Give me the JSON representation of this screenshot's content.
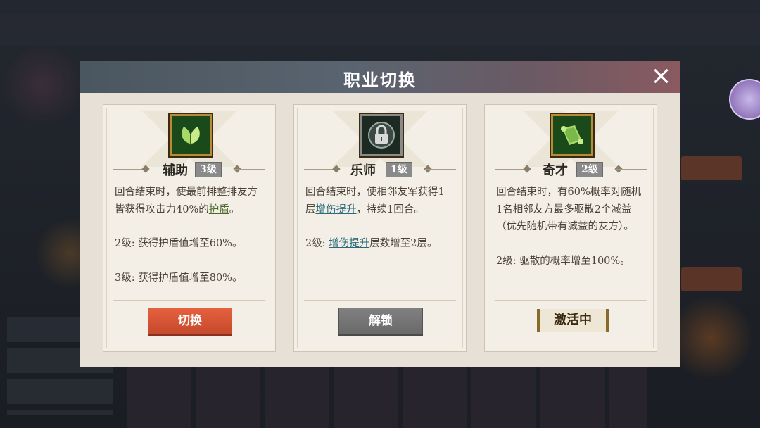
{
  "modal": {
    "title": "职业切换"
  },
  "cards": [
    {
      "name": "辅助",
      "level": "3级",
      "icon": "leaf-icon",
      "desc1_a": "回合结束时，使最前排整排友方皆获得攻击力40%的",
      "desc1_kw": "护盾",
      "desc1_b": "。",
      "desc2": "2级: 获得护盾值增至60%。",
      "desc3": "3级: 获得护盾值增至80%。",
      "button": "切换"
    },
    {
      "name": "乐师",
      "level": "1级",
      "icon": "lock-icon",
      "desc1_a": "回合结束时，使相邻友军获得1层",
      "desc1_kw": "增伤提升",
      "desc1_b": "，持续1回合。",
      "desc2_a": "2级: ",
      "desc2_kw": "增伤提升",
      "desc2_b": "层数增至2层。",
      "button": "解锁"
    },
    {
      "name": "奇才",
      "level": "2级",
      "icon": "scroll-icon",
      "desc1": "回合结束时，有60%概率对随机1名相邻友方最多驱散2个减益（优先随机带有减益的友方）。",
      "desc2": "2级: 驱散的概率增至100%。",
      "status": "激活中"
    }
  ]
}
